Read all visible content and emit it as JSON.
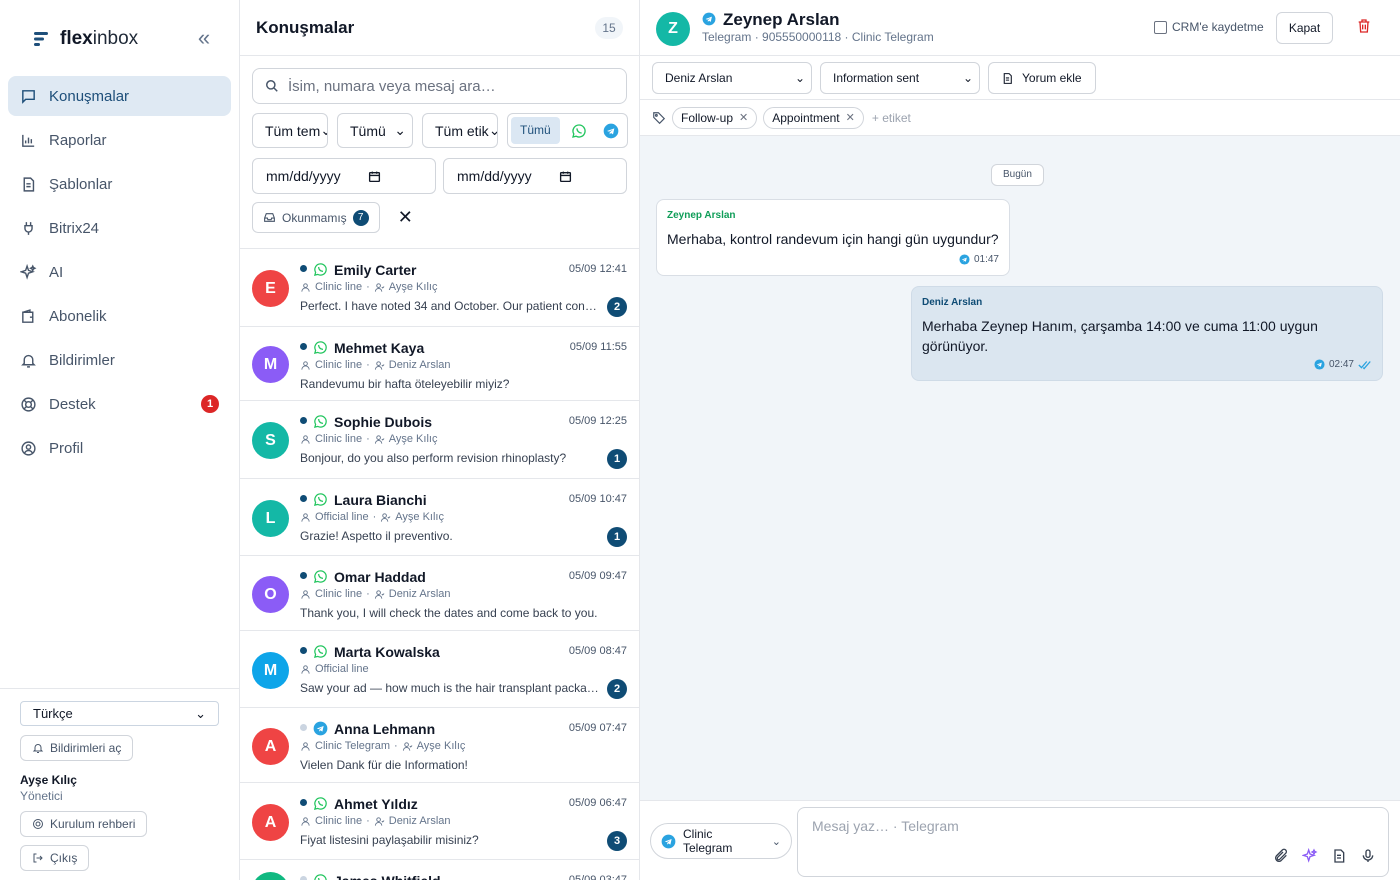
{
  "app": {
    "brand_a": "flex",
    "brand_b": "inbox",
    "collapse_icon": "chevrons-left-icon"
  },
  "sidebar": {
    "items": [
      {
        "label": "Konuşmalar",
        "icon": "chat-icon",
        "active": true
      },
      {
        "label": "Raporlar",
        "icon": "bar-chart-icon"
      },
      {
        "label": "Şablonlar",
        "icon": "document-icon"
      },
      {
        "label": "Bitrix24",
        "icon": "plug-icon"
      },
      {
        "label": "AI",
        "icon": "sparkle-icon"
      },
      {
        "label": "Abonelik",
        "icon": "wallet-icon"
      },
      {
        "label": "Bildirimler",
        "icon": "bell-icon"
      },
      {
        "label": "Destek",
        "icon": "lifebuoy-icon",
        "badge": "1"
      },
      {
        "label": "Profil",
        "icon": "user-circle-icon"
      }
    ],
    "language": "Türkçe",
    "notifications_btn": "Bildirimleri aç",
    "user_name": "Ayşe Kılıç",
    "user_role": "Yönetici",
    "setup_btn": "Kurulum rehberi",
    "logout_btn": "Çıkış"
  },
  "list": {
    "title": "Konuşmalar",
    "count": "15",
    "search_placeholder": "İsim, numara veya mesaj ara…",
    "filter_team": "Tüm tem",
    "filter_status": "Tümü",
    "filter_tag": "Tüm etik",
    "channel_all": "Tümü",
    "date_from": "mm/dd/yyyy",
    "date_to": "mm/dd/yyyy",
    "unread_label": "Okunmamış",
    "unread_count": "7",
    "conversations": [
      {
        "initial": "E",
        "color": "#ef4444",
        "name": "Emily Carter",
        "channel": "whatsapp",
        "unread": true,
        "time": "05/09 12:41",
        "line": "Clinic line",
        "agent": "Ayşe Kılıç",
        "message": "Perfect. I have noted 34 and October. Our patient con…",
        "badge": "2"
      },
      {
        "initial": "M",
        "color": "#8b5cf6",
        "name": "Mehmet Kaya",
        "channel": "whatsapp",
        "unread": true,
        "time": "05/09 11:55",
        "line": "Clinic line",
        "agent": "Deniz Arslan",
        "message": "Randevumu bir hafta öteleyebilir miyiz?",
        "badge": ""
      },
      {
        "initial": "S",
        "color": "#14b8a6",
        "name": "Sophie Dubois",
        "channel": "whatsapp",
        "unread": true,
        "time": "05/09 12:25",
        "line": "Clinic line",
        "agent": "Ayşe Kılıç",
        "message": "Bonjour, do you also perform revision rhinoplasty?",
        "badge": "1"
      },
      {
        "initial": "L",
        "color": "#14b8a6",
        "name": "Laura Bianchi",
        "channel": "whatsapp",
        "unread": true,
        "time": "05/09 10:47",
        "line": "Official line",
        "agent": "Ayşe Kılıç",
        "message": "Grazie! Aspetto il preventivo.",
        "badge": "1"
      },
      {
        "initial": "O",
        "color": "#8b5cf6",
        "name": "Omar Haddad",
        "channel": "whatsapp",
        "unread": true,
        "time": "05/09 09:47",
        "line": "Clinic line",
        "agent": "Deniz Arslan",
        "message": "Thank you, I will check the dates and come back to you.",
        "badge": ""
      },
      {
        "initial": "M",
        "color": "#0ea5e9",
        "name": "Marta Kowalska",
        "channel": "whatsapp",
        "unread": true,
        "time": "05/09 08:47",
        "line": "Official line",
        "agent": "",
        "message": "Saw your ad — how much is the hair transplant packa…",
        "badge": "2"
      },
      {
        "initial": "A",
        "color": "#ef4444",
        "name": "Anna Lehmann",
        "channel": "telegram",
        "unread": false,
        "time": "05/09 07:47",
        "line": "Clinic Telegram",
        "agent": "Ayşe Kılıç",
        "message": "Vielen Dank für die Information!",
        "badge": ""
      },
      {
        "initial": "A",
        "color": "#ef4444",
        "name": "Ahmet Yıldız",
        "channel": "whatsapp",
        "unread": true,
        "time": "05/09 06:47",
        "line": "Clinic line",
        "agent": "Deniz Arslan",
        "message": "Fiyat listesini paylaşabilir misiniz?",
        "badge": "3"
      },
      {
        "initial": "J",
        "color": "#10b981",
        "name": "James Whitfield",
        "channel": "whatsapp",
        "unread": false,
        "time": "05/09 03:47",
        "line": "",
        "agent": "",
        "message": "",
        "badge": ""
      }
    ]
  },
  "chat": {
    "initial": "Z",
    "name": "Zeynep Arslan",
    "subtitle": "Telegram · 905550000118 · Clinic Telegram",
    "crm_label": "CRM'e kaydetme",
    "close_btn": "Kapat",
    "assignee": "Deniz Arslan",
    "stage": "Information sent",
    "comment_btn": "Yorum ekle",
    "tags": [
      "Follow-up",
      "Appointment"
    ],
    "add_tag": "+ etiket",
    "day_label": "Bugün",
    "messages": [
      {
        "sender": "Zeynep Arslan",
        "text": "Merhaba, kontrol randevum için hangi gün uygundur?",
        "time": "01:47"
      },
      {
        "sender": "Deniz Arslan",
        "text": "Merhaba Zeynep Hanım, çarşamba 14:00 ve cuma 11:00 uygun görünüyor.",
        "time": "02:47"
      }
    ],
    "compose_channel": "Clinic Telegram",
    "compose_placeholder": "Mesaj yaz… · Telegram"
  },
  "colors": {
    "accent": "#0f4c75",
    "whatsapp": "#22c55e",
    "telegram": "#2aa3e0",
    "danger": "#dc2626"
  }
}
